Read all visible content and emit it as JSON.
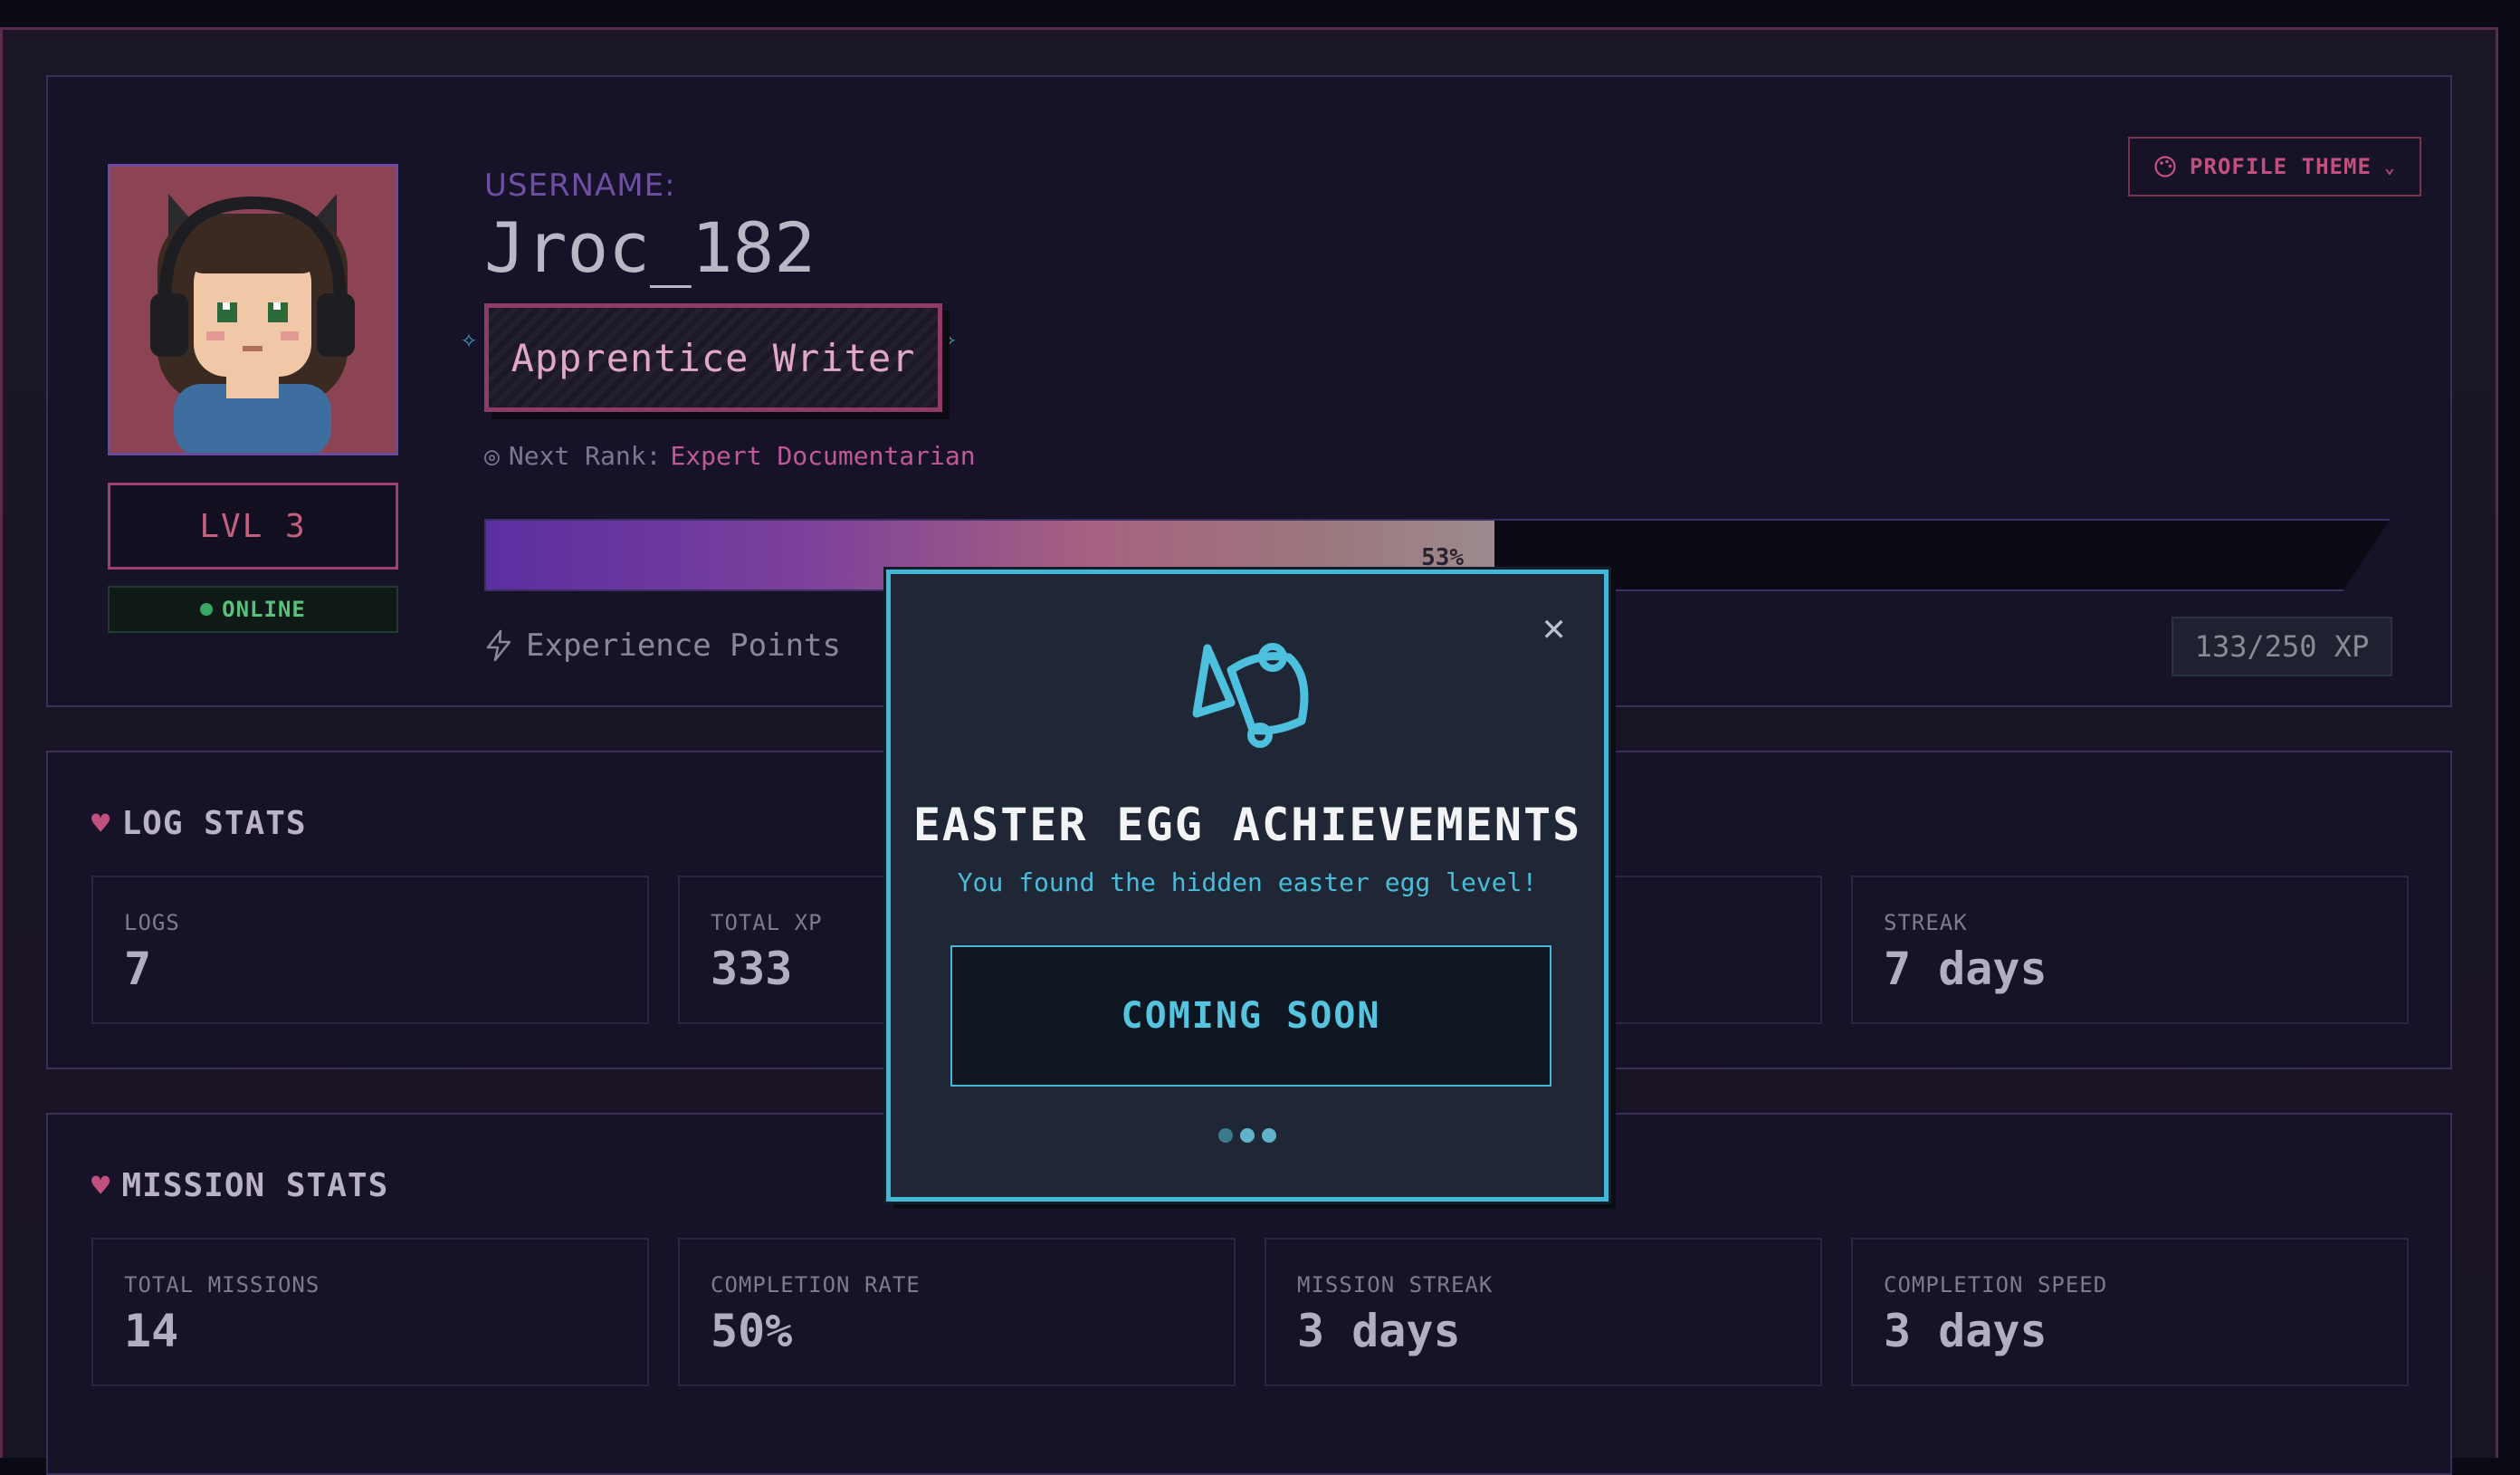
{
  "profile": {
    "username_label": "USERNAME:",
    "username": "Jroc_182",
    "rank": "Apprentice Writer",
    "next_rank_label": "Next Rank:",
    "next_rank": "Expert Documentarian",
    "level": "LVL 3",
    "status": "ONLINE",
    "xp_percent_label": "53%",
    "xp_percent": 53,
    "xp_label": "Experience Points",
    "xp_count": "133/250 XP",
    "theme_button": "PROFILE THEME"
  },
  "log_stats": {
    "title": "LOG STATS",
    "cards": [
      {
        "label": "LOGS",
        "value": "7"
      },
      {
        "label": "TOTAL XP",
        "value": "333"
      },
      {
        "label": "",
        "value": ""
      },
      {
        "label": "STREAK",
        "value": "7 days"
      }
    ]
  },
  "mission_stats": {
    "title": "MISSION STATS",
    "cards": [
      {
        "label": "TOTAL MISSIONS",
        "value": "14"
      },
      {
        "label": "COMPLETION RATE",
        "value": "50%"
      },
      {
        "label": "MISSION STREAK",
        "value": "3 days"
      },
      {
        "label": "COMPLETION SPEED",
        "value": "3 days"
      }
    ]
  },
  "modal": {
    "icon": "megaphone-icon",
    "title": "EASTER EGG ACHIEVEMENTS",
    "subtitle": "You found the hidden easter egg level!",
    "button": "COMING SOON"
  },
  "colors": {
    "accent_pink": "#c0507e",
    "accent_cyan": "#43b8d6",
    "online_green": "#58c27c"
  }
}
